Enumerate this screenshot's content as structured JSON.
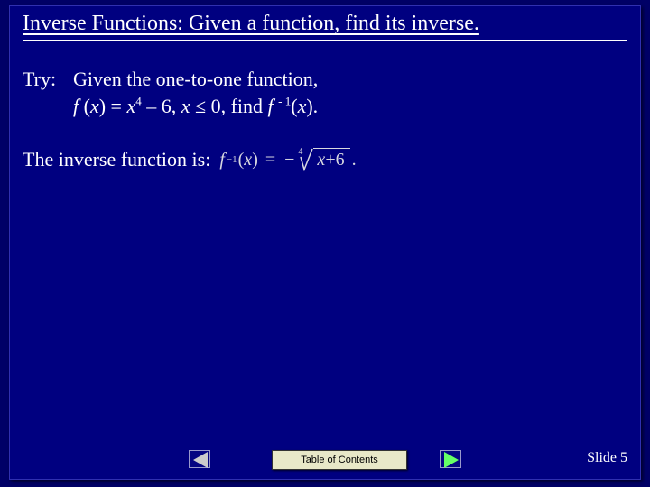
{
  "title": "Inverse Functions: Given a function, find its inverse.",
  "try": {
    "label": "Try:",
    "line1": "Given the one-to-one function,",
    "fx_prefix": "f ",
    "fx_open": "(",
    "fx_x": "x",
    "fx_close": ")",
    "eq": "  =  ",
    "x": "x",
    "exp4": "4",
    "mid": "  –  6, ",
    "xvar": "x ",
    "le": " ≤ ",
    "zero": " 0",
    "find": ", find  ",
    "f2": "f ",
    "negexp": "- 1",
    "fx2_open": "(",
    "fx2_x": "x",
    "fx2_close": ").",
    "inverse_label": "The inverse function is:"
  },
  "formula": {
    "f": "f",
    "sup": "−1",
    "open": "(",
    "x": "x",
    "close": ")",
    "eq": "=",
    "neg": "−",
    "index": "4",
    "rad_x": "x",
    "rad_plus": " + ",
    "rad_six": "6",
    "period": "."
  },
  "footer": {
    "toc": "Table of Contents",
    "slide": "Slide 5"
  },
  "icons": {
    "prev": "triangle-left",
    "next": "triangle-right"
  }
}
